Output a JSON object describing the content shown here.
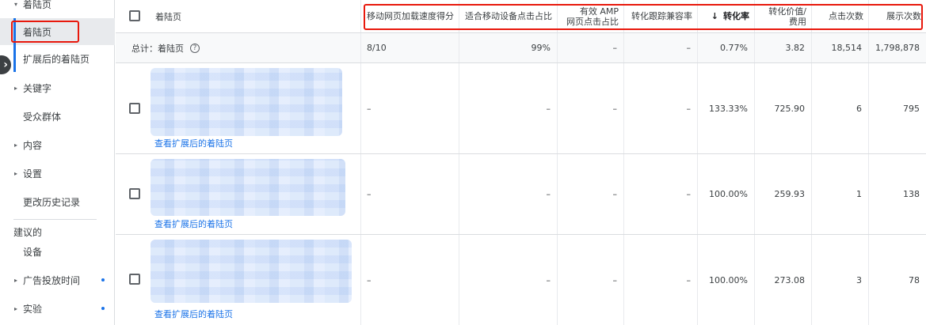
{
  "sidebar": {
    "top_label": "着陆页",
    "items": [
      {
        "label": "着陆页"
      },
      {
        "label": "扩展后的着陆页"
      },
      {
        "label": "关键字"
      },
      {
        "label": "受众群体"
      },
      {
        "label": "内容"
      },
      {
        "label": "设置"
      },
      {
        "label": "更改历史记录"
      }
    ],
    "section_label": "建议的",
    "section_items": [
      {
        "label": "设备"
      },
      {
        "label": "广告投放时间"
      },
      {
        "label": "实验"
      }
    ],
    "collapse_icon": "›"
  },
  "table": {
    "headers": {
      "landing_page": "着陆页",
      "speed": "移动网页加载速度得分",
      "mobile_click": "适合移动设备点击占比",
      "amp_line1": "有效 AMP",
      "amp_line2": "网页点击占比",
      "tracking": "转化跟踪兼容率",
      "sort_arrow": "↓",
      "conv_rate": "转化率",
      "value_cost_line1": "转化价值/",
      "value_cost_line2": "费用",
      "clicks": "点击次数",
      "impressions": "展示次数"
    },
    "total": {
      "label": "总计：着陆页",
      "help_icon": "?",
      "speed": "8/10",
      "mobile_click": "99%",
      "amp": "–",
      "tracking": "–",
      "conv_rate": "0.77%",
      "value_cost": "3.82",
      "clicks": "18,514",
      "impressions": "1,798,878"
    },
    "rows": [
      {
        "link": "查看扩展后的着陆页",
        "speed": "–",
        "mobile_click": "–",
        "amp": "–",
        "tracking": "–",
        "conv_rate": "133.33%",
        "value_cost": "725.90",
        "clicks": "6",
        "impressions": "795"
      },
      {
        "link": "查看扩展后的着陆页",
        "speed": "–",
        "mobile_click": "–",
        "amp": "–",
        "tracking": "–",
        "conv_rate": "100.00%",
        "value_cost": "259.93",
        "clicks": "1",
        "impressions": "138"
      },
      {
        "link": "查看扩展后的着陆页",
        "speed": "–",
        "mobile_click": "–",
        "amp": "–",
        "tracking": "–",
        "conv_rate": "100.00%",
        "value_cost": "273.08",
        "clicks": "3",
        "impressions": "78"
      }
    ]
  },
  "colors": {
    "accent": "#1a73e8",
    "highlight": "#e8180c",
    "border": "#dadce0"
  }
}
